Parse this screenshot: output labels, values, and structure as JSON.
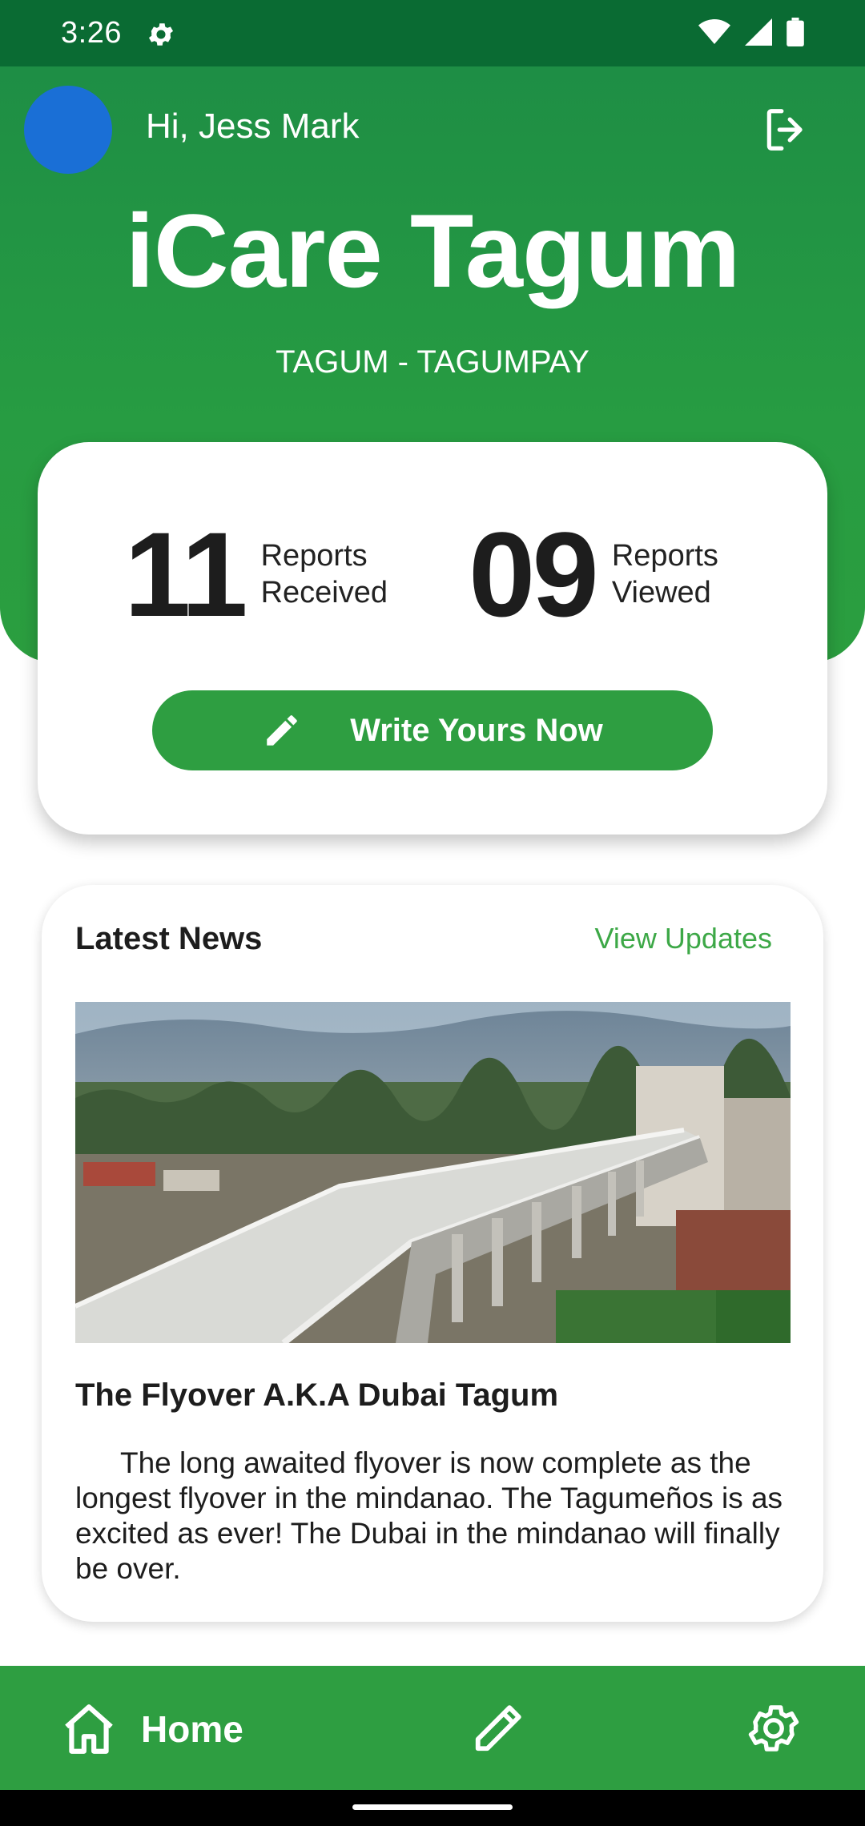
{
  "status_bar": {
    "time": "3:26",
    "icons": [
      "settings-icon",
      "wifi-icon",
      "signal-icon",
      "battery-icon"
    ]
  },
  "header": {
    "greeting": "Hi, Jess Mark",
    "app_title": "iCare Tagum",
    "subtitle": "TAGUM - TAGUMPAY",
    "logout_icon": "logout-icon"
  },
  "stats": {
    "received": {
      "count": "11",
      "label_line1": "Reports",
      "label_line2": "Received"
    },
    "viewed": {
      "count": "09",
      "label_line1": "Reports",
      "label_line2": "Viewed"
    },
    "write_button": "Write Yours Now"
  },
  "news": {
    "section_title": "Latest News",
    "view_updates": "View Updates",
    "headline": "The Flyover A.K.A Dubai Tagum",
    "body": "The long awaited flyover is now complete as the longest flyover in the mindanao. The Tagumeños is as excited as ever! The Dubai in the mindanao will finally be over."
  },
  "bottom_nav": {
    "home_label": "Home",
    "icons": [
      "home-icon",
      "pencil-icon",
      "settings-icon"
    ]
  },
  "colors": {
    "primary_green": "#2e9e41",
    "status_bar": "#0a6b33",
    "link_green": "#3da847",
    "avatar_blue": "#1a6fd6"
  }
}
